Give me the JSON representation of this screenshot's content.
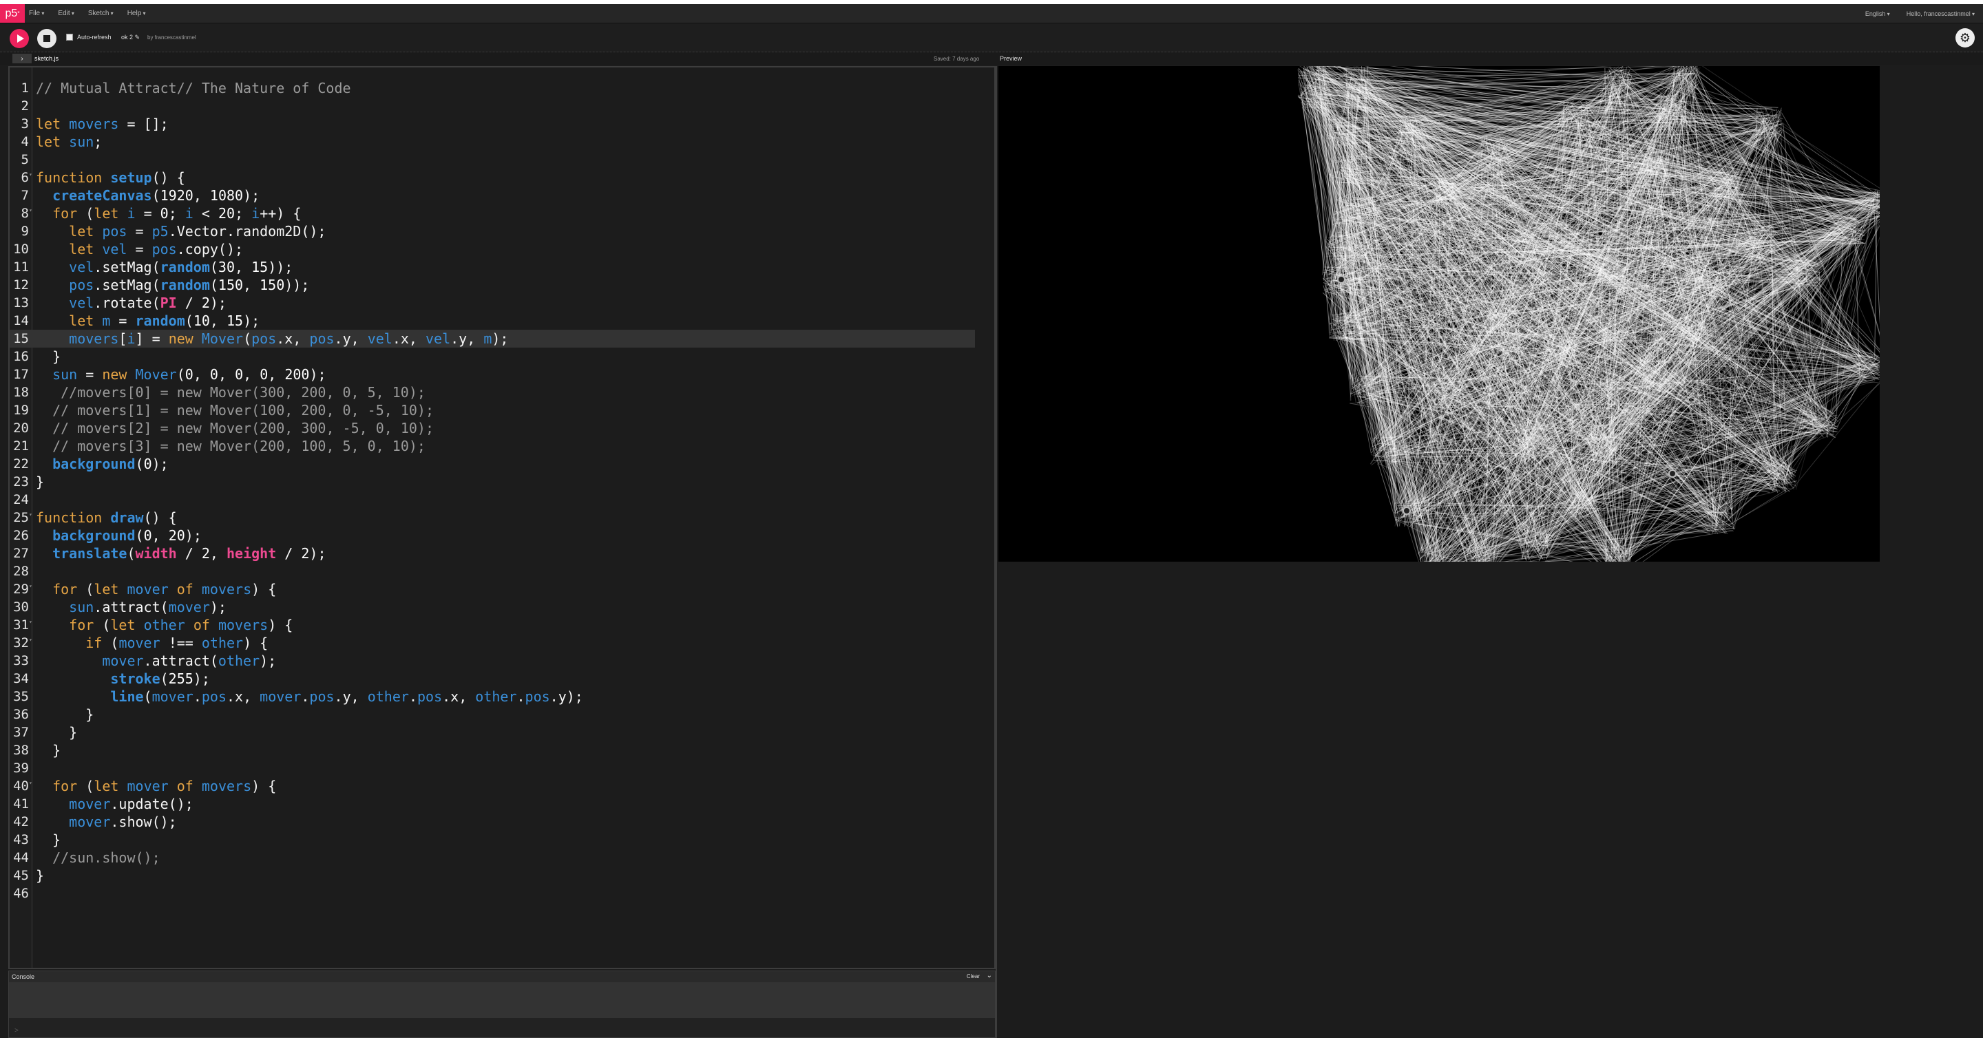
{
  "nav": {
    "logo": "p5",
    "menus": [
      "File",
      "Edit",
      "Sketch",
      "Help"
    ],
    "language": "English",
    "user": "Hello, francescastinmel"
  },
  "toolbar": {
    "auto_refresh_label": "Auto-refresh",
    "sketch_name": "ok 2",
    "by_label": "by francescastinmel"
  },
  "files": {
    "tab": "sketch.js",
    "saved_status": "Saved: 7 days ago",
    "preview_label": "Preview"
  },
  "editor": {
    "highlighted_line": 15,
    "lines": [
      "1",
      "2",
      "3",
      "4",
      "5",
      "6",
      "7",
      "8",
      "9",
      "10",
      "11",
      "12",
      "13",
      "14",
      "15",
      "16",
      "17",
      "18",
      "19",
      "20",
      "21",
      "22",
      "23",
      "24",
      "25",
      "26",
      "27",
      "28",
      "29",
      "30",
      "31",
      "32",
      "33",
      "34",
      "35",
      "36",
      "37",
      "38",
      "39",
      "40",
      "41",
      "42",
      "43",
      "44",
      "45",
      "46"
    ],
    "code": [
      "// Mutual Attract// The Nature of Code",
      "",
      "let movers = [];",
      "let sun;",
      "",
      "function setup() {",
      "  createCanvas(1920, 1080);",
      "  for (let i = 0; i < 20; i++) {",
      "    let pos = p5.Vector.random2D();",
      "    let vel = pos.copy();",
      "    vel.setMag(random(30, 15));",
      "    pos.setMag(random(150, 150));",
      "    vel.rotate(PI / 2);",
      "    let m = random(10, 15);",
      "    movers[i] = new Mover(pos.x, pos.y, vel.x, vel.y, m);",
      "  }",
      "  sun = new Mover(0, 0, 0, 0, 200);",
      "   //movers[0] = new Mover(300, 200, 0, 5, 10);",
      "  // movers[1] = new Mover(100, 200, 0, -5, 10);",
      "  // movers[2] = new Mover(200, 300, -5, 0, 10);",
      "  // movers[3] = new Mover(200, 100, 5, 0, 10);",
      "  background(0);",
      "}",
      "",
      "function draw() {",
      "  background(0, 20);",
      "  translate(width / 2, height / 2);",
      "",
      "  for (let mover of movers) {",
      "    sun.attract(mover);",
      "    for (let other of movers) {",
      "      if (mover !== other) {",
      "        mover.attract(other);",
      "         stroke(255);",
      "         line(mover.pos.x, mover.pos.y, other.pos.x, other.pos.y);",
      "      }",
      "    }",
      "  }",
      "",
      "  for (let mover of movers) {",
      "    mover.update();",
      "    mover.show();",
      "  }",
      "  //sun.show();",
      "}",
      ""
    ]
  },
  "console": {
    "title": "Console",
    "clear_label": "Clear",
    "prompt": ">"
  }
}
